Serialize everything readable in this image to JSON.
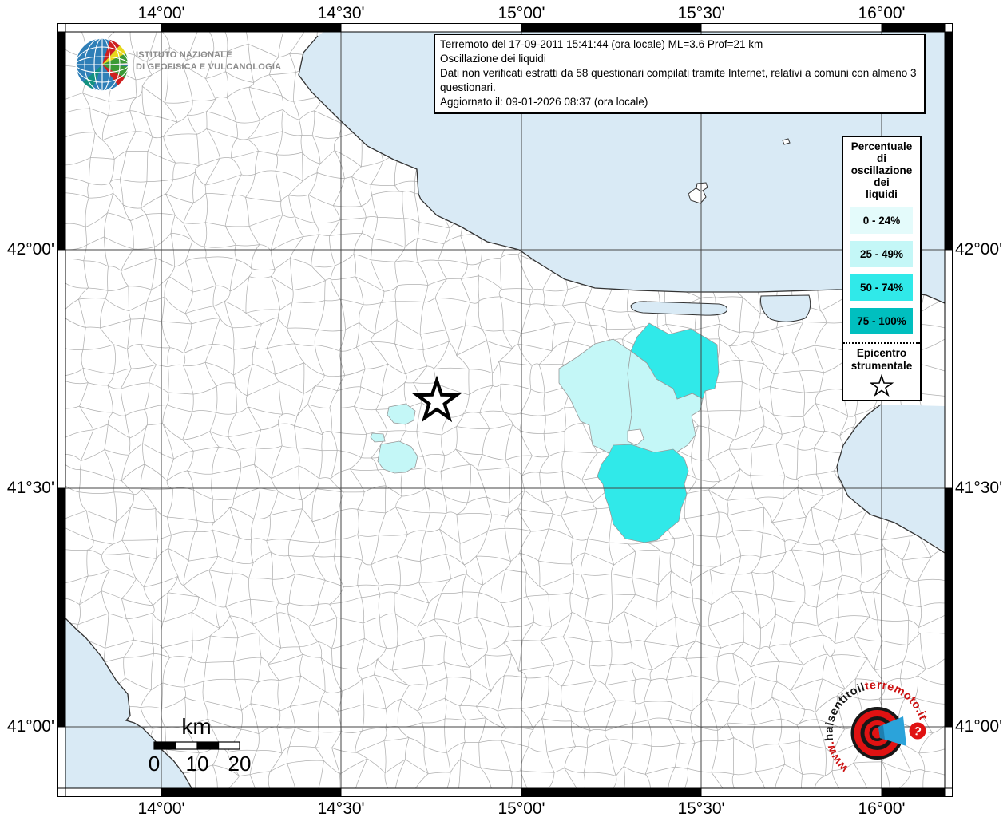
{
  "header": {
    "info_box_lines": [
      "Terremoto del 17-09-2011 15:41:44 (ora locale) ML=3.6 Prof=21 km",
      "Oscillazione dei liquidi",
      "Dati non verificati estratti da 58 questionari compilati tramite Internet, relativi a comuni con almeno 3 questionari.",
      "Aggiornato il: 09-01-2026 08:37 (ora locale)"
    ],
    "ingv_logo_lines": [
      "ISTITUTO NAZIONALE",
      "DI GEOFISICA E VULCANOLOGIA"
    ]
  },
  "legend": {
    "title_lines": [
      "Percentuale",
      "di",
      "oscillazione",
      "dei",
      "liquidi"
    ],
    "classes": [
      {
        "label": "0 - 24%",
        "color": "#e4fbfb"
      },
      {
        "label": "25 - 49%",
        "color": "#c4f7f7"
      },
      {
        "label": "50 - 74%",
        "color": "#30e9e9"
      },
      {
        "label": "75 - 100%",
        "color": "#00bfbf"
      }
    ],
    "epicenter_label_lines": [
      "Epicentro",
      "strumentale"
    ]
  },
  "axes": {
    "top": [
      "14°00'",
      "14°30'",
      "15°00'",
      "15°30'",
      "16°00'"
    ],
    "bottom": [
      "14°00'",
      "14°30'",
      "15°00'",
      "15°30'",
      "16°00'"
    ],
    "left": [
      "42°00'",
      "41°30'",
      "41°00'"
    ],
    "right": [
      "42°00'",
      "41°30'",
      "41°00'"
    ]
  },
  "scalebar": {
    "unit": "km",
    "ticks": [
      "0",
      "10",
      "20"
    ]
  },
  "watermark": {
    "url_prefix": "www.",
    "url_black": "haisentitoil",
    "url_red": "terremoto.it",
    "question_mark": "?"
  },
  "map": {
    "sea_color": "#d9eaf5",
    "land_color": "#ffffff"
  }
}
